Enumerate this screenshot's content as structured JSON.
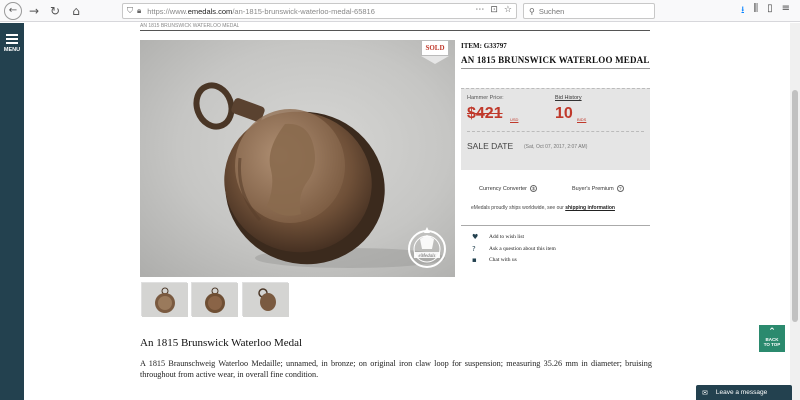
{
  "browser": {
    "url_prefix": "https://www.",
    "url_domain": "emedals.com",
    "url_path": "/an-1815-brunswick-waterloo-medal-65816",
    "search_placeholder": "Suchen"
  },
  "menu": {
    "label": "MENU"
  },
  "breadcrumb": "AN 1815 BRUNSWICK WATERLOO MEDAL",
  "product": {
    "item_no": "ITEM: G33797",
    "title": "AN 1815 BRUNSWICK WATERLOO MEDAL",
    "sold_badge": "SOLD",
    "watermark": "eMedals"
  },
  "pricing": {
    "hammer_label": "Hammer Price:",
    "hammer_value": "$421",
    "hammer_currency": "USD",
    "bid_history_label": "Bid History",
    "bid_count": "10",
    "bid_unit": "BIDS",
    "sale_label": "SALE DATE",
    "sale_date": "(Sat, Oct 07, 2017, 2:07 AM)"
  },
  "links": {
    "currency_converter": "Currency Converter",
    "buyers_premium": "Buyer's Premium",
    "shipping_note_prefix": "eMedals proudly ships worldwide, see our ",
    "shipping_link": "shipping information"
  },
  "actions": [
    {
      "icon": "heart-icon",
      "glyph": "♥",
      "label": "Add to wish list"
    },
    {
      "icon": "question-icon",
      "glyph": "?",
      "label": "Ask a question about this item"
    },
    {
      "icon": "chat-icon",
      "glyph": "▪",
      "label": "Chat with us"
    }
  ],
  "description": {
    "title": "An 1815 Brunswick Waterloo Medal",
    "body": "A 1815 Braunschweig Waterloo Medaille; unnamed, in bronze; on original iron claw loop for suspension; measuring 35.26 mm in diameter; bruising throughout from active wear, in overall fine condition."
  },
  "back_to_top": {
    "line1": "BACK",
    "line2": "TO TOP"
  },
  "chat_widget": {
    "label": "Leave a message"
  }
}
